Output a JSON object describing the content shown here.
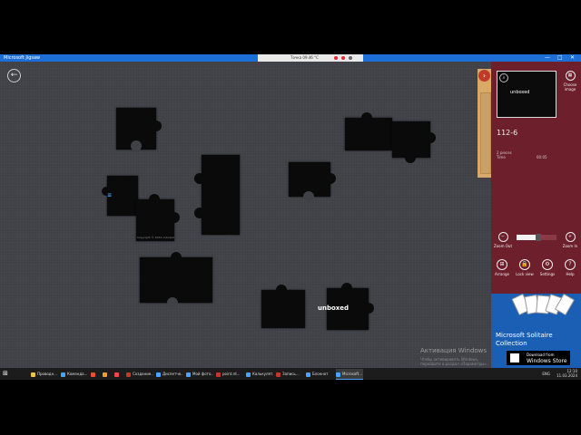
{
  "window": {
    "title": "Microsoft Jigsaw",
    "controls": [
      "—",
      "□",
      "✕"
    ],
    "toolbar_zoom": "Точка 09.46 °C"
  },
  "board": {
    "back_icon": "←",
    "side_arrow": "›",
    "logo_text": "unboxed",
    "piece_caption": "Copyright © 2024 unboxed",
    "watermark_title": "Активация Windows",
    "watermark_sub": "Чтобы активировать Windows, перейдите в раздел «Параметры»."
  },
  "panel": {
    "chosen_label": "Choose image",
    "puzzle_number": "112-6",
    "stats": [
      {
        "label": "2 pieces",
        "value": ""
      },
      {
        "label": "Time",
        "value": "00:05"
      }
    ],
    "zoom_out": "Zoom Out",
    "zoom_in": "Zoom In",
    "zoom_level": 0.55,
    "buttons": [
      {
        "label": "Arrange",
        "icon": "⊞"
      },
      {
        "label": "Lock view",
        "icon": "🔒"
      },
      {
        "label": "Settings",
        "icon": "⚙"
      },
      {
        "label": "Help",
        "icon": "?"
      }
    ]
  },
  "ad": {
    "title_line1": "Microsoft Solitaire",
    "title_line2": "Collection",
    "store_small": "Download from",
    "store_big": "Windows Store"
  },
  "taskbar": {
    "items": [
      {
        "label": "Проводн...",
        "color": "#f0c24a"
      },
      {
        "label": "Команда...",
        "color": "#4aa3ff"
      },
      {
        "label": "",
        "color": "#e8532c"
      },
      {
        "label": "",
        "color": "#e8a02c"
      },
      {
        "label": "",
        "color": "#e84a4a"
      },
      {
        "label": "Создание...",
        "color": "#c0392b"
      },
      {
        "label": "Диспетче...",
        "color": "#4aa3ff"
      },
      {
        "label": "Мой фото...",
        "color": "#4aa3ff"
      },
      {
        "label": "point.rd...",
        "color": "#c0392b"
      },
      {
        "label": "Калькулят...",
        "color": "#4aa3ff"
      },
      {
        "label": "Запись...",
        "color": "#c0392b"
      },
      {
        "label": "Блокнот",
        "color": "#4aa3ff"
      },
      {
        "label": "Microsoft...",
        "color": "#4aa3ff"
      }
    ],
    "lang": "ENG",
    "time": "12:10",
    "date": "11.03.2024"
  }
}
